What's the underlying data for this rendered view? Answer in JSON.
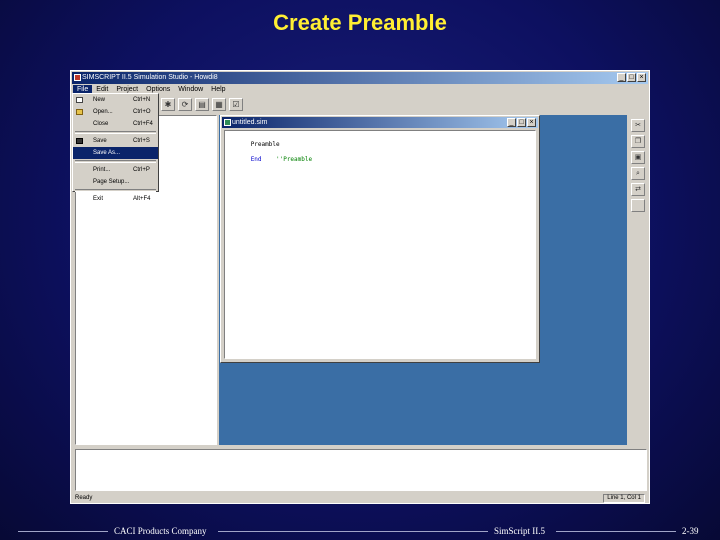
{
  "slide": {
    "title": "Create Preamble"
  },
  "app": {
    "title": "SIMSCRIPT II.5 Simulation Studio - Howdi8",
    "window_buttons": [
      "_",
      "□",
      "×"
    ],
    "menus": [
      "File",
      "Edit",
      "Project",
      "Options",
      "Window",
      "Help"
    ],
    "active_menu": "File"
  },
  "file_menu": {
    "items": [
      {
        "label": "New",
        "shortcut": "Ctrl+N",
        "icon": "new-file-icon"
      },
      {
        "label": "Open...",
        "shortcut": "Ctrl+O",
        "icon": "open-folder-icon"
      },
      {
        "label": "Close",
        "shortcut": "Ctrl+F4",
        "icon": ""
      },
      {
        "label": "Save",
        "shortcut": "Ctrl+S",
        "icon": "save-disk-icon"
      },
      {
        "label": "Save As...",
        "shortcut": "",
        "icon": "",
        "selected": true
      },
      {
        "label": "Print...",
        "shortcut": "Ctrl+P",
        "icon": ""
      },
      {
        "label": "Page Setup...",
        "shortcut": "",
        "icon": ""
      },
      {
        "label": "Exit",
        "shortcut": "Alt+F4",
        "icon": ""
      }
    ]
  },
  "toolbar": {
    "buttons": [
      "bug-icon",
      "compile-icon",
      "print-icon",
      "build-icon",
      "properties-icon"
    ],
    "right_buttons": [
      "cut-icon",
      "copy-icon",
      "paste-icon",
      "find-icon",
      "replace-icon",
      "blank-icon"
    ]
  },
  "editor": {
    "title": "untitled.sim",
    "lines": [
      {
        "parts": [
          {
            "t": "Preamble",
            "cls": ""
          }
        ]
      },
      {
        "parts": [
          {
            "t": "End",
            "cls": "kw"
          },
          {
            "t": "    ''Preamble",
            "cls": "cm"
          }
        ]
      }
    ]
  },
  "status": {
    "left": "Ready",
    "right": "Line 1, Col 1"
  },
  "footer": {
    "left": "CACI Products Company",
    "center": "SimScript II.5",
    "right": "2-39"
  },
  "colors": {
    "slide_bg": "#0d1060",
    "title": "#ffee33",
    "mdi_bg": "#3a6ea5",
    "titlebar": "#0a246a"
  }
}
